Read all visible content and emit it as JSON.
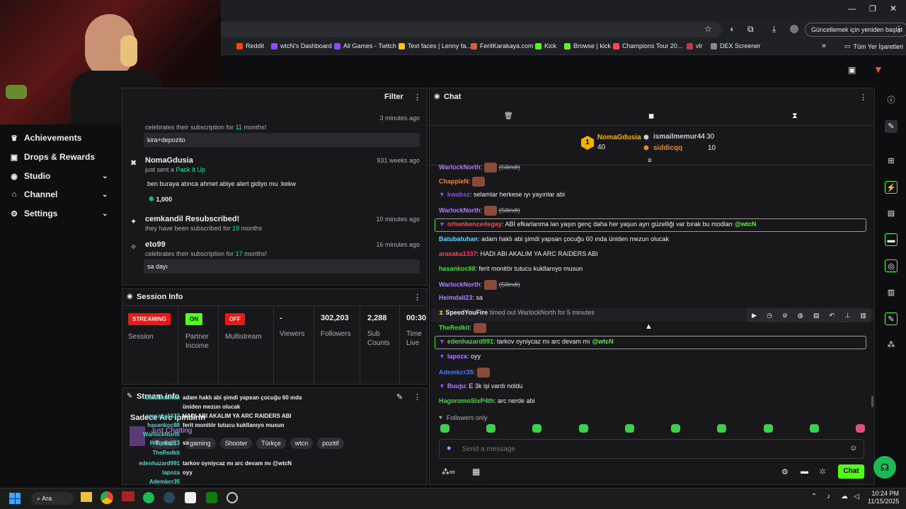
{
  "browser": {
    "restart_label": "Güncellemek için yeniden başlat",
    "bookmarks": [
      {
        "label": "Reddit",
        "color": "#ff4500"
      },
      {
        "label": "wtcN's Dashboard",
        "color": "#9146ff"
      },
      {
        "label": "All Games - Twitch",
        "color": "#9146ff"
      },
      {
        "label": "Text faces | Lenny fa...",
        "color": "#f5c518"
      },
      {
        "label": "FeritKarakaya.com",
        "color": "#e05a2b"
      },
      {
        "label": "Kick",
        "color": "#53fc18"
      },
      {
        "label": "Browse | kick",
        "color": "#53fc18"
      },
      {
        "label": "Champions Tour 20...",
        "color": "#ff4655"
      },
      {
        "label": "vlr",
        "color": "#bd3b4e"
      },
      {
        "label": "DEX Screener",
        "color": "#888888"
      }
    ],
    "all_bookmarks_label": "Tüm Yer İşaretleri"
  },
  "nav": {
    "items": [
      {
        "label": "Achievements"
      },
      {
        "label": "Drops & Rewards"
      },
      {
        "label": "Studio"
      },
      {
        "label": "Channel"
      },
      {
        "label": "Settings"
      }
    ]
  },
  "activity": {
    "filter_label": "Filter",
    "events": [
      {
        "title": "",
        "subtitle_pre": "celebrates their subscription for ",
        "subtitle_num": "11",
        "subtitle_post": " months!",
        "time": "3 minutes ago",
        "message": "kira+depozito"
      },
      {
        "title": "NomaGdusia",
        "subtitle_pre": "just sent a ",
        "subtitle_num": "Pack It Up",
        "subtitle_post": "",
        "time": "931 weeks ago",
        "message": "ben buraya atınca ahmet abiye alert gidiyo mu :kekw",
        "amount": "1,000"
      },
      {
        "title": "cemkandil Resubscribed!",
        "subtitle_pre": "they have been subscribed for ",
        "subtitle_num": "19",
        "subtitle_post": " months",
        "time": "10 minutes ago",
        "message": ""
      },
      {
        "title": "eto99",
        "subtitle_pre": "celebrates their subscription for ",
        "subtitle_num": "17",
        "subtitle_post": " months!",
        "time": "16 minutes ago",
        "message": "sa dayı"
      }
    ]
  },
  "session": {
    "title": "Session Info",
    "streaming_badge": "STREAMING",
    "session_label": "Session",
    "partner_badge": "ON",
    "partner_label": "Partner Income",
    "multistream_badge": "OFF",
    "multistream_label": "Multistream",
    "viewers_value": "-",
    "viewers_label": "Viewers",
    "followers_value": "302,203",
    "followers_label": "Followers",
    "subs_value": "2,288",
    "subs_label": "Sub Counts",
    "time_value": "00:30:",
    "time_label": "Time Live"
  },
  "stream_info": {
    "title": "Stream info",
    "stream_title": "Sadece Arc Ipindirin",
    "category": "Just Chatting",
    "tags": [
      "Turkish",
      "gaming",
      "Shooter",
      "Türkçe",
      "wtcn",
      "pozitif"
    ]
  },
  "chat": {
    "title": "Chat",
    "leaderboard": [
      {
        "name": "NomaGdusia",
        "value": "40"
      },
      {
        "name": "ismailmemur44",
        "value": "30"
      },
      {
        "name": "siddicqq",
        "value": "10"
      }
    ],
    "messages": [
      {
        "user": "WarlockNorth",
        "color": "#b07cff",
        "text": "(Silindi)",
        "deleted": true
      },
      {
        "user": "ChappieN",
        "color": "#ff7f24",
        "text": "",
        "emote": true
      },
      {
        "user": "kwabsz",
        "color": "#9146ff",
        "text": "selamlar herkese ıyı yayınlar abi"
      },
      {
        "user": "WarlockNorth",
        "color": "#b07cff",
        "text": "(Silindi)",
        "deleted": true
      },
      {
        "user": "orhanbencedegay",
        "color": "#ff4646",
        "text": "ABİ efkarlanma lan yaşın genç daha her yaşun ayrı güzelliği var bırak bu modları",
        "mention": "@wtcN",
        "highlight": true
      },
      {
        "user": "Batubatuhan",
        "color": "#5dd6ff",
        "text": "adam haklı abi şimdi yapsan çocuğu 60 ında üniden mezun olucak"
      },
      {
        "user": "arasaka1337",
        "color": "#ff3b5c",
        "text": "HADI ABI AKALIM YA ARC RAIDERS ABI"
      },
      {
        "user": "hasankoc88",
        "color": "#45d93a",
        "text": "ferit monitör tutucu kukllanıyo musun"
      },
      {
        "user": "WarlockNorth",
        "color": "#b07cff",
        "text": "(Silindi)",
        "deleted": true
      },
      {
        "user": "Heimdall23",
        "color": "#b07cff",
        "text": "sa"
      },
      {
        "user": "SpeedYouFire",
        "color": "#efeff1",
        "text": "timed out WarlockNorth for 5 minutes",
        "system": true
      },
      {
        "user": "TheRedkit",
        "color": "#45d93a",
        "text": "",
        "emote": true
      },
      {
        "user": "edenhazard991",
        "color": "#45d93a",
        "text": "tarkov oyniycaz mı arc devam mı",
        "mention": "@wtcN",
        "highlight": true
      },
      {
        "user": "lapoza",
        "color": "#b07cff",
        "text": "oyy"
      },
      {
        "user": "Ademkcr35",
        "color": "#3b7bff",
        "text": "",
        "emote": true
      },
      {
        "user": "Buuju",
        "color": "#b07cff",
        "text": "E 3k işi vardı noldu"
      },
      {
        "user": "HagoromoSixP4th",
        "color": "#45d93a",
        "text": "arc nerde abi"
      }
    ],
    "followers_only": "Followers only",
    "input_placeholder": "Send a message",
    "send_label": "Chat"
  },
  "overlay_chat": [
    {
      "user": "Batubatuhan",
      "text": "adam haklı abi şimdi yapsan çocuğu 60 ında"
    },
    {
      "user": "",
      "text": "üniden mezun olucak"
    },
    {
      "user": "arasaka1337",
      "text": "HADI ABI AKALIM YA ARC RAIDERS ABI"
    },
    {
      "user": "hasankoc88",
      "text": "ferit monitör tutucu kukllanıyo musun"
    },
    {
      "user": "WarlockNorth",
      "text": ""
    },
    {
      "user": "Heimdall23",
      "text": "sa"
    },
    {
      "user": "TheRedkit",
      "text": ""
    },
    {
      "user": "edenhazard991",
      "text": "tarkov oyniycaz mı arc devam mı @wtcN"
    },
    {
      "user": "lapoza",
      "text": "oyy"
    },
    {
      "user": "Ademkcr35",
      "text": ""
    },
    {
      "user": "Buuju",
      "text": "E 3k işi vardı noldu"
    }
  ],
  "taskbar": {
    "search_label": "Ara",
    "time": "10:24 PM",
    "date": "11/15/2025"
  },
  "colors": {
    "accent_green": "#53fc18",
    "streaming_red": "#e91916",
    "twitch_purple": "#9146ff"
  }
}
